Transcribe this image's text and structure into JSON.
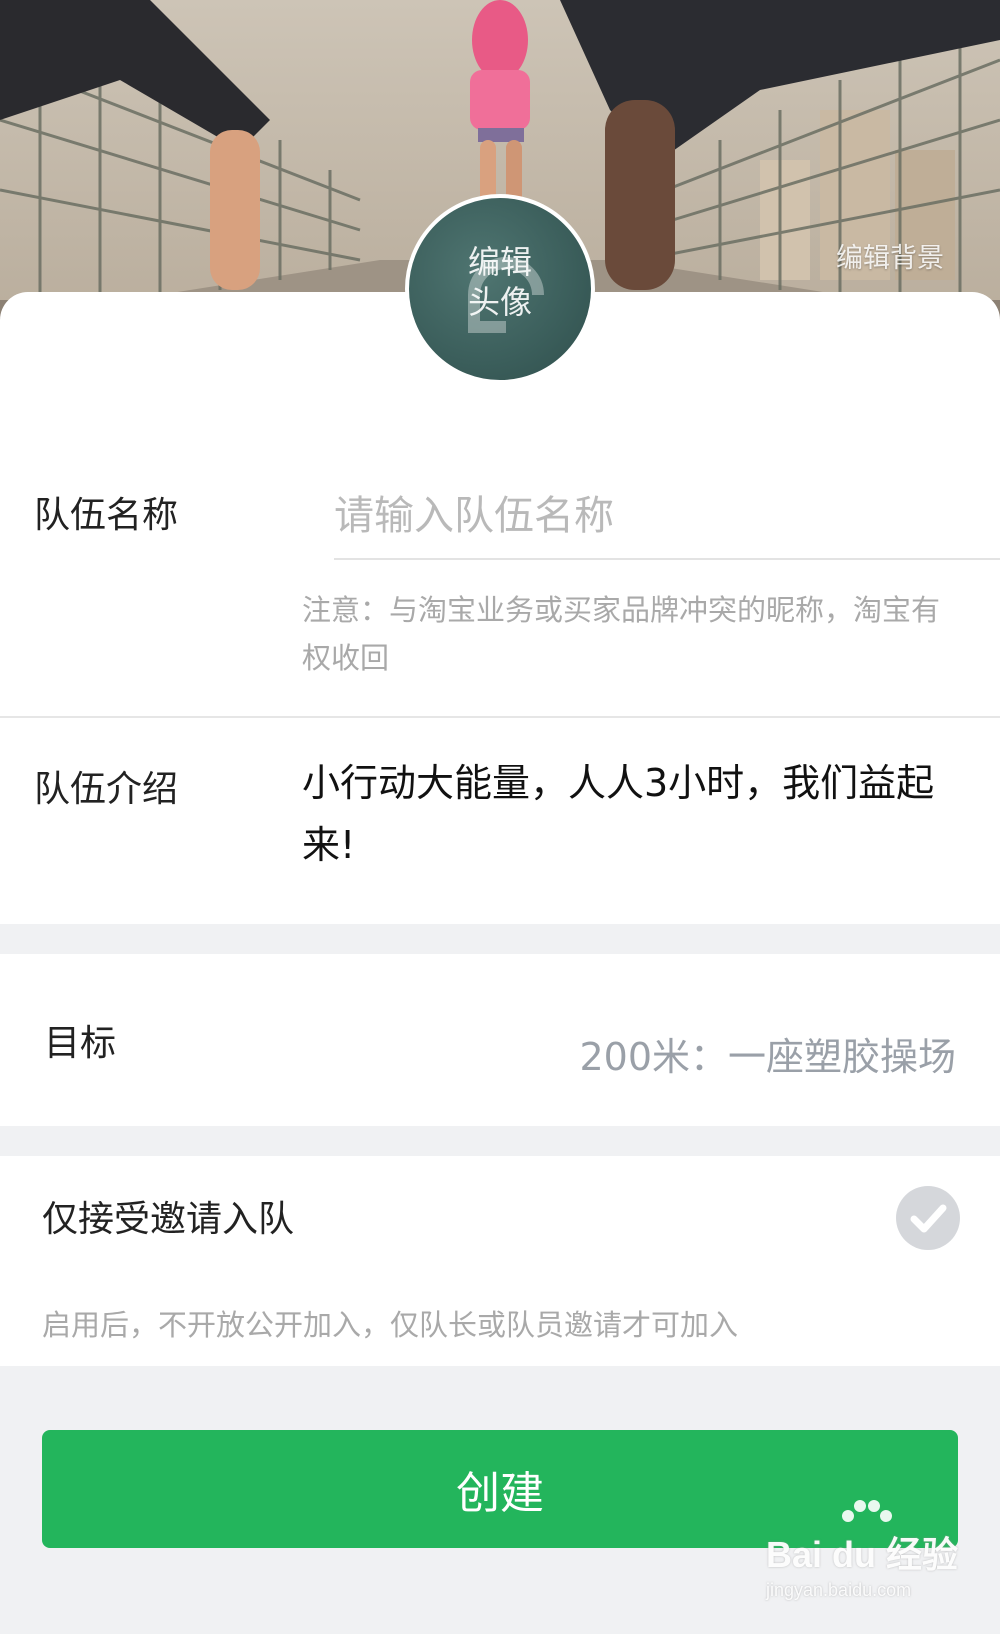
{
  "header": {
    "edit_background_label": "编辑背景",
    "edit_avatar_label_line1": "编辑",
    "edit_avatar_label_line2": "头像"
  },
  "form": {
    "team_name": {
      "label": "队伍名称",
      "placeholder": "请输入队伍名称",
      "notice": "注意：与淘宝业务或买家品牌冲突的昵称，淘宝有权收回"
    },
    "team_intro": {
      "label": "队伍介绍",
      "value": "小行动大能量，人人3小时，我们益起来!"
    },
    "goal": {
      "label": "目标",
      "value": "200米：一座塑胶操场"
    },
    "invite_only": {
      "label": "仅接受邀请入队",
      "hint": "启用后，不开放公开加入，仅队长或队员邀请才可加入",
      "checked": true
    }
  },
  "actions": {
    "create_label": "创建"
  },
  "watermark": {
    "brand": "Bai du 经验",
    "url": "jingyan.baidu.com"
  },
  "colors": {
    "accent": "#23b55c",
    "avatar_bg": "#3b5e5b",
    "muted_text": "#a9a9a9"
  }
}
